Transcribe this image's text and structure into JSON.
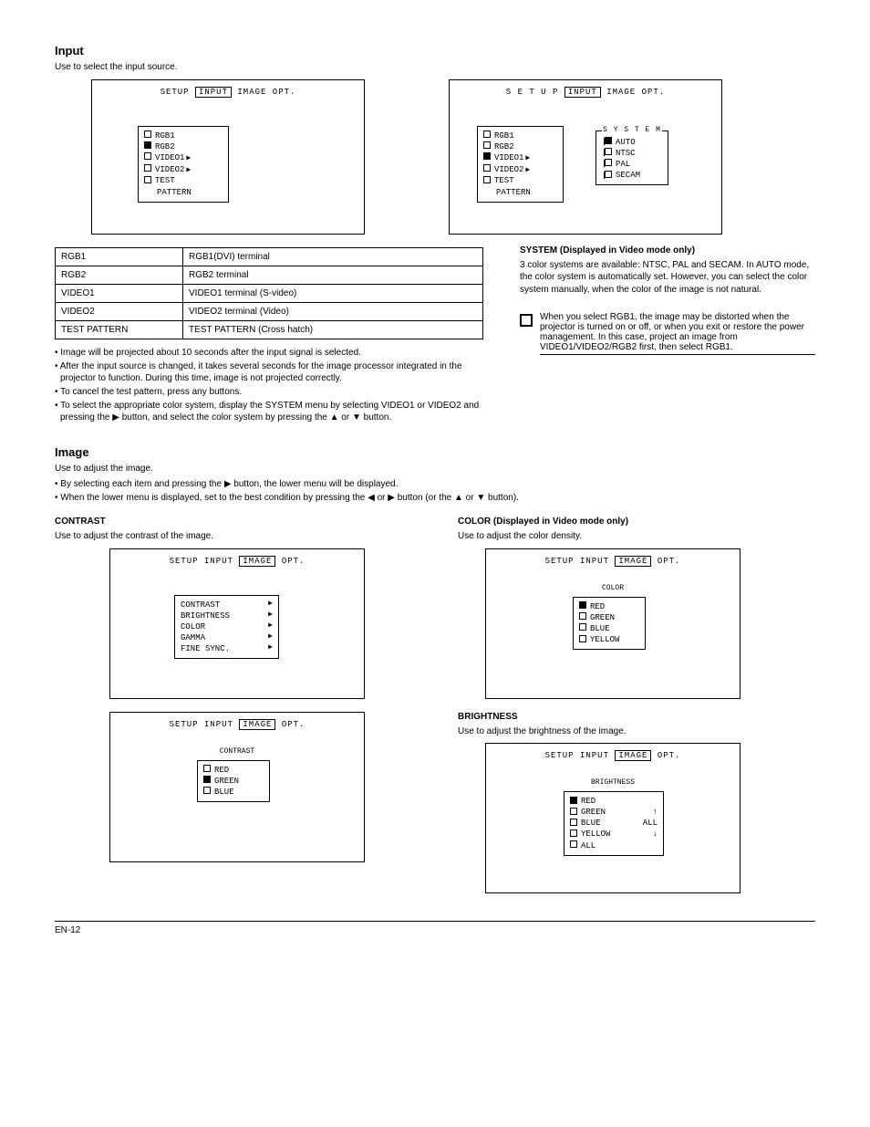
{
  "headings": {
    "input": "Input",
    "input_desc": "Use to select the input source.",
    "image": "Image",
    "image_desc": "Use to adjust the image.",
    "contrast": "CONTRAST",
    "contrast_desc": "Use to adjust the contrast of the image.",
    "color": "COLOR (Displayed in Video mode only)",
    "color_desc": "Use to adjust the color density.",
    "system": "SYSTEM (Displayed in Video mode only)",
    "system_desc": "3 color systems are available: NTSC, PAL and SECAM. In AUTO mode, the color system is automatically set. However, you can select the color system manually, when the color of the image is not natural.",
    "bright": "BRIGHTNESS",
    "bright_desc": "Use to adjust the brightness of the image."
  },
  "note_text": "When you select RGB1, the image may be distorted when the projector is turned on or off, or when you exit or restore the power management. In this case, project an image from VIDEO1/VIDEO2/RGB2 first, then select RGB1.",
  "table": {
    "rows": [
      [
        "RGB1",
        "RGB1(DVI) terminal"
      ],
      [
        "RGB2",
        "RGB2 terminal"
      ],
      [
        "VIDEO1",
        "VIDEO1 terminal (S-video)"
      ],
      [
        "VIDEO2",
        "VIDEO2 terminal (Video)"
      ],
      [
        "TEST PATTERN",
        "TEST PATTERN (Cross hatch)"
      ]
    ]
  },
  "bullets": [
    "• Image will be projected about 10 seconds after the input signal is selected.",
    "• After the input source is changed, it takes several seconds for the image processor integrated in the projector to function. During this time, image is not projected correctly.",
    "• To cancel the test pattern, press any buttons.",
    "• To select the appropriate color system, display the SYSTEM menu by selecting VIDEO1 or VIDEO2 and pressing the ▶ button, and select the color system by pressing the ▲ or ▼ button."
  ],
  "image_bullets": [
    "• By selecting each item and pressing the ▶ button, the lower menu will be displayed.",
    "• When the lower menu is displayed, set to the best condition by pressing the ◀ or ▶ button (or the ▲ or ▼ button)."
  ],
  "osd1": {
    "tabs_pre": "SETUP",
    "tabs_boxed": "INPUT",
    "tabs_post": "IMAGE OPT.",
    "items": [
      {
        "label": "RGB1",
        "filled": false,
        "arrow": false
      },
      {
        "label": "RGB2",
        "filled": true,
        "arrow": false
      },
      {
        "label": "VIDEO1",
        "filled": false,
        "arrow": true
      },
      {
        "label": "VIDEO2",
        "filled": false,
        "arrow": true
      },
      {
        "label": "TEST",
        "filled": false,
        "arrow": false
      },
      {
        "label": "PATTERN",
        "filled": false,
        "arrow": false,
        "indent": true
      }
    ]
  },
  "osd2": {
    "tabs_pre": "S E T U P",
    "tabs_boxed": "INPUT",
    "tabs_post": "IMAGE OPT.",
    "items": [
      {
        "label": "RGB1",
        "filled": false
      },
      {
        "label": "RGB2",
        "filled": false
      },
      {
        "label": "VIDEO1",
        "filled": true,
        "arrow": true
      },
      {
        "label": "VIDEO2",
        "filled": false,
        "arrow": true
      },
      {
        "label": "TEST",
        "filled": false
      },
      {
        "label": "PATTERN",
        "indent": true
      }
    ],
    "system_title": "S Y S T E M",
    "system_items": [
      {
        "label": "AUTO",
        "filled": true
      },
      {
        "label": "NTSC",
        "filled": false
      },
      {
        "label": "PAL",
        "filled": false
      },
      {
        "label": "SECAM",
        "filled": false
      }
    ]
  },
  "osd3": {
    "tabs_pre": "SETUP INPUT",
    "tabs_boxed": "IMAGE",
    "tabs_post": "OPT.",
    "items": [
      {
        "label": "CONTRAST",
        "arrow": true
      },
      {
        "label": "BRIGHTNESS",
        "arrow": true
      },
      {
        "label": "COLOR",
        "arrow": true
      },
      {
        "label": "GAMMA",
        "arrow": true
      },
      {
        "label": "FINE SYNC.",
        "arrow": true
      }
    ]
  },
  "osd4": {
    "tabs_pre": "SETUP INPUT",
    "tabs_boxed": "IMAGE",
    "tabs_post": "OPT.",
    "box_title": "CONTRAST",
    "items": [
      {
        "label": "RED",
        "filled": false
      },
      {
        "label": "GREEN",
        "filled": true
      },
      {
        "label": "BLUE",
        "filled": false
      }
    ]
  },
  "osd5": {
    "tabs_pre": "SETUP INPUT",
    "tabs_boxed": "IMAGE",
    "tabs_post": "OPT.",
    "box_title": "COLOR",
    "items": [
      {
        "label": "RED",
        "filled": true
      },
      {
        "label": "GREEN",
        "filled": false
      },
      {
        "label": "BLUE",
        "filled": false
      },
      {
        "label": "YELLOW",
        "filled": false
      }
    ]
  },
  "osd6": {
    "tabs_pre": "SETUP INPUT",
    "tabs_boxed": "IMAGE",
    "tabs_post": "OPT.",
    "box_title": "BRIGHTNESS",
    "items": [
      {
        "label": "RED",
        "filled": true,
        "suffix": ""
      },
      {
        "label": "GREEN",
        "filled": false,
        "suffix": "↑"
      },
      {
        "label": "BLUE",
        "filled": false,
        "suffix": "ALL"
      },
      {
        "label": "YELLOW",
        "filled": false,
        "suffix": "↓"
      },
      {
        "label": "ALL",
        "filled": false,
        "suffix": ""
      }
    ]
  },
  "footer": {
    "left": "EN-12",
    "right": ""
  }
}
